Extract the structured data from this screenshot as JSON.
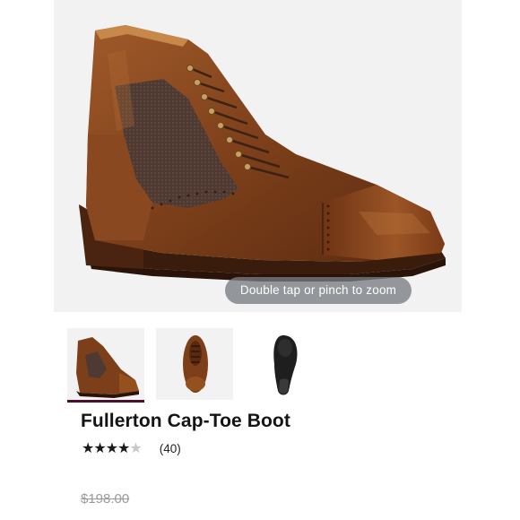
{
  "product_image": {
    "zoom_hint": "Double tap or pinch to zoom"
  },
  "thumbnails": [
    {
      "view": "side",
      "active": true
    },
    {
      "view": "top",
      "active": false
    },
    {
      "view": "sole",
      "active": false
    }
  ],
  "product": {
    "title": "Fullerton Cap-Toe Boot",
    "rating": 4,
    "rating_max": 5,
    "stars_full": "★★★★",
    "stars_empty": "★",
    "review_count": "(40)",
    "price": "$198.00",
    "sale_price": " "
  },
  "colors": {
    "leather": "#7a3f1c",
    "tweed": "#4e3a32",
    "sole": "#3a1c0d",
    "active_indicator": "#4a1030"
  },
  "icons": [
    "zoom-hint",
    "star-icon"
  ]
}
